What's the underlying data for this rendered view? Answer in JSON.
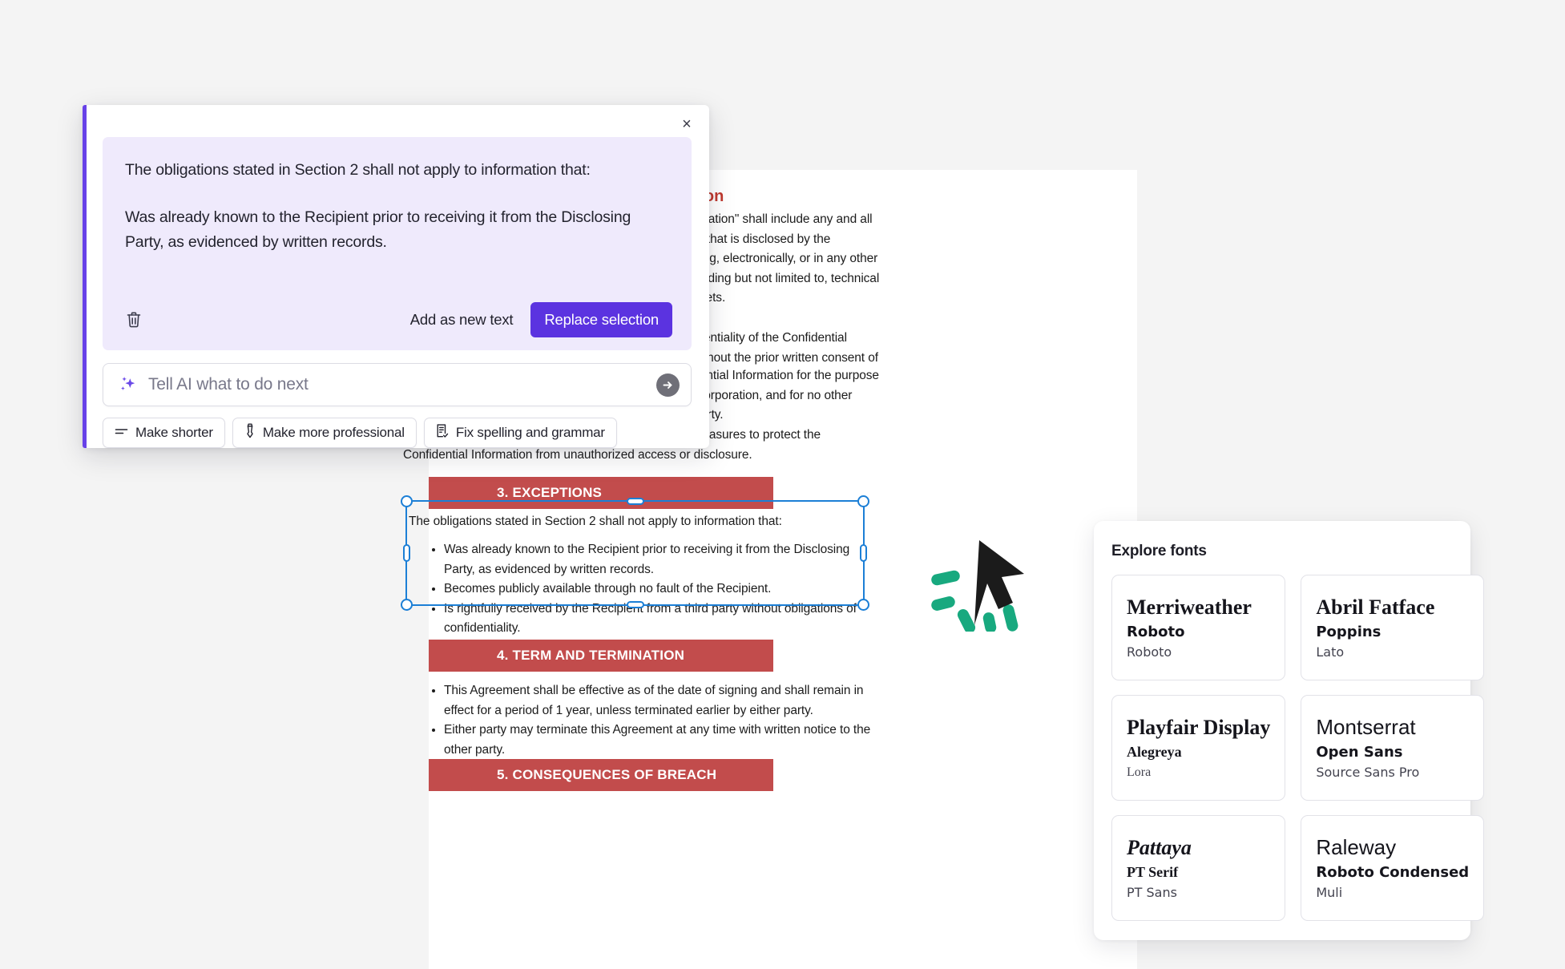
{
  "document": {
    "sections": [
      {
        "kind": "red-heading",
        "heading": "1. DEFINITION OF CONFIDENTIAL INFORMATION",
        "visible_heading_fragment": "rmation"
      },
      {
        "kind": "paragraph",
        "text": "For the purposes of this Agreement, \"Confidential Information\" shall include any and all information, data, documents, materials and knowledge that is disclosed by the Disclosing Party to the Recipient, whether orally, in writing, electronically, or in any other form, and is identified as confidential or proprietary, including but not limited to, technical information, financial data, customer lists and trade secrets."
      },
      {
        "kind": "paragraph",
        "text": "Non-Disclosure: The Recipient shall maintain the confidentiality of the Confidential Information and shall not disclose it to any third party without the prior written consent of the Disclosing Party."
      },
      {
        "kind": "paragraph",
        "text": "Use Limitation: The Recipient shall only use the Confidential Information for the purpose of conducting due diligence for the acquisition of XYZ Corporation, and for no other purpose without the written consent of the Disclosing Party."
      },
      {
        "kind": "paragraph",
        "text": "Duty of Care: The Recipient shall take all reasonable measures to protect the Confidential Information from unauthorized access or disclosure."
      }
    ],
    "section3": {
      "title": "3. EXCEPTIONS",
      "lead": "The obligations stated in Section 2 shall not apply to information that:",
      "bullets": [
        "Was already known to the Recipient prior to receiving it from the Disclosing Party, as evidenced by written records.",
        "Becomes publicly available through no fault of the Recipient.",
        "Is rightfully received by the Recipient from a third party without obligations of confidentiality."
      ]
    },
    "section4": {
      "title": "4. TERM AND TERMINATION",
      "bullets": [
        "This Agreement shall be effective as of the date of signing and shall remain in effect for a period of 1 year, unless terminated earlier by either party.",
        "Either party may terminate this Agreement at any time with written notice to the other party."
      ]
    },
    "section5": {
      "title": "5. CONSEQUENCES OF BREACH"
    },
    "colors": {
      "section_band": "#c24c4c",
      "red_heading": "#c0392f",
      "selection": "#1C7FD6"
    }
  },
  "ai_panel": {
    "close_label": "×",
    "result": {
      "paragraph_1": "The obligations stated in Section 2 shall not apply to information that:",
      "paragraph_2": "Was already known to the Recipient prior to receiving it from the Disclosing Party, as evidenced by written records."
    },
    "actions": {
      "discard_icon": "trash-icon",
      "add_as_new_text": "Add as new text",
      "replace_selection": "Replace selection"
    },
    "input": {
      "leading_icon": "sparkle-icon",
      "placeholder": "Tell AI what to do next",
      "value": "",
      "submit_icon": "arrow-right-circle-icon"
    },
    "quick_actions": [
      {
        "label": "Make shorter",
        "icon": "shorten-lines-icon"
      },
      {
        "label": "Make more professional",
        "icon": "necktie-icon"
      },
      {
        "label": "Fix spelling and grammar",
        "icon": "document-check-icon"
      }
    ],
    "accent_color": "#6741e8",
    "primary_button_color": "#5b33e0",
    "result_background": "#efeafc"
  },
  "fonts_panel": {
    "title": "Explore fonts",
    "cards": [
      {
        "display": "Merriweather",
        "bold": "Roboto",
        "regular": "Roboto"
      },
      {
        "display": "Abril Fatface",
        "bold": "Poppins",
        "regular": "Lato"
      },
      {
        "display": "Playfair Display",
        "bold": "Alegreya",
        "regular": "Lora"
      },
      {
        "display": "Montserrat",
        "bold": "Open Sans",
        "regular": "Source Sans Pro"
      },
      {
        "display": "Pattaya",
        "bold": "PT Serif",
        "regular": "PT Sans"
      },
      {
        "display": "Raleway",
        "bold": "Roboto Condensed",
        "regular": "Muli"
      }
    ]
  },
  "cursor": {
    "icon": "arrow-cursor-click-icon",
    "accent_color": "#18a97f"
  }
}
